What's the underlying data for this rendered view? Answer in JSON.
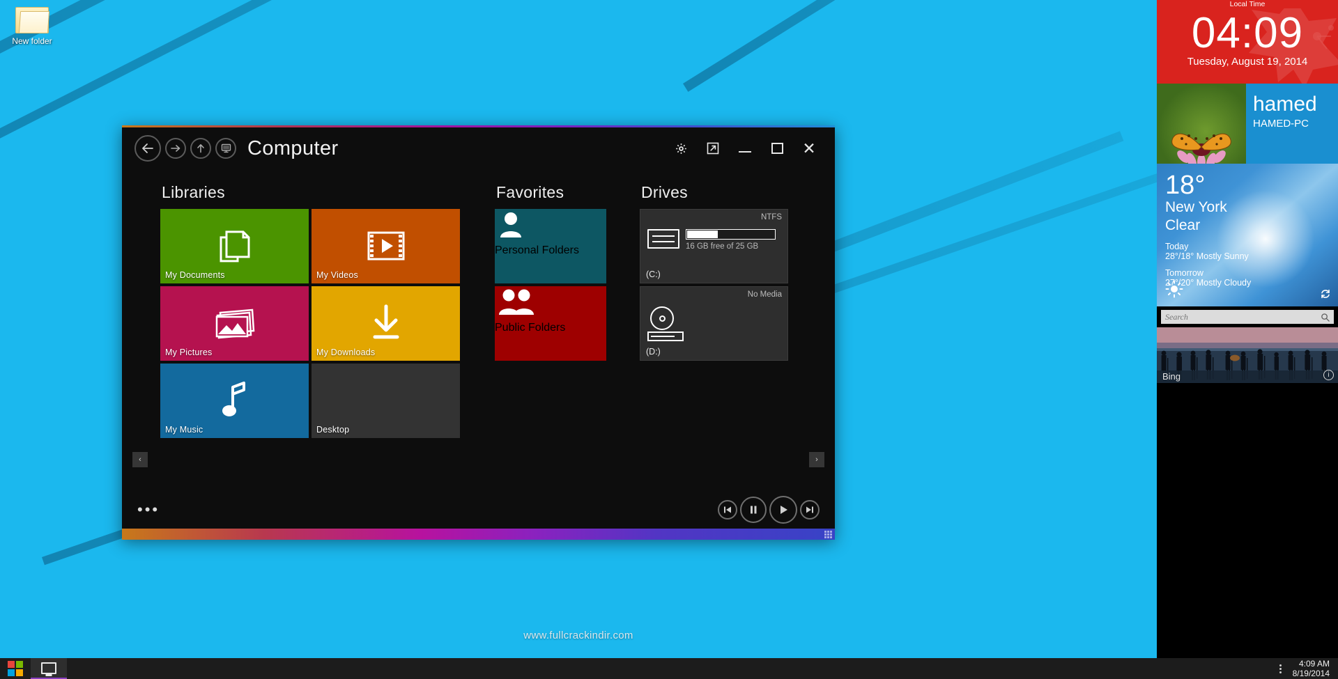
{
  "desktop": {
    "icon_label": "New folder",
    "watermark": "www.fullcrackindir.com",
    "wallpaper_color": "#1bb8ee"
  },
  "window": {
    "title": "Computer",
    "nav": {
      "back": "back-arrow",
      "forward": "forward-arrow",
      "up": "up-arrow",
      "computer": "computer-monitor"
    },
    "titlebar_buttons": {
      "settings": "gear-icon",
      "popout": "popout-icon",
      "minimize": "minimize-icon",
      "maximize": "maximize-icon",
      "close": "close-icon"
    },
    "sections": {
      "libraries": {
        "heading": "Libraries",
        "tiles": [
          {
            "label": "My Documents",
            "color": "#4b9400",
            "icon": "documents-icon"
          },
          {
            "label": "My Videos",
            "color": "#c14f00",
            "icon": "video-film-icon"
          },
          {
            "label": "My Pictures",
            "color": "#b5124f",
            "icon": "pictures-icon"
          },
          {
            "label": "My Downloads",
            "color": "#e2a600",
            "icon": "download-arrow-icon"
          },
          {
            "label": "My Music",
            "color": "#136a9e",
            "icon": "music-note-icon"
          },
          {
            "label": "Desktop",
            "color": "#333333",
            "icon": "desktop-icon"
          }
        ]
      },
      "favorites": {
        "heading": "Favorites",
        "tiles": [
          {
            "label": "Personal Folders",
            "color": "#0d5763",
            "icon": "single-person-icon"
          },
          {
            "label": "Public Folders",
            "color": "#9e0000",
            "icon": "two-people-icon"
          }
        ]
      },
      "drives": {
        "heading": "Drives",
        "items": [
          {
            "letter": "(C:)",
            "filesystem": "NTFS",
            "capacity_text": "16 GB free of 25 GB",
            "used_percent": 36,
            "icon": "hard-drive-icon"
          },
          {
            "letter": "(D:)",
            "filesystem": "No Media",
            "capacity_text": "",
            "used_percent": 0,
            "icon": "optical-drive-icon"
          }
        ]
      }
    },
    "scroll_left": "‹",
    "scroll_right": "›",
    "more_menu": "•••",
    "media_controls": {
      "previous": "previous-track-icon",
      "pause": "pause-icon",
      "play": "play-icon",
      "next": "next-track-icon"
    }
  },
  "sidepanel": {
    "local_time_label": "Local Time",
    "clock": {
      "time": "04:09",
      "date": "Tuesday, August 19, 2014",
      "color": "#d9231e"
    },
    "user": {
      "name": "hamed",
      "pc": "HAMED-PC",
      "tile_color": "#1a8fd0"
    },
    "weather": {
      "temperature": "18°",
      "city": "New York",
      "condition": "Clear",
      "today_label": "Today",
      "today_value": "28°/18° Mostly Sunny",
      "tomorrow_label": "Tomorrow",
      "tomorrow_value": "27°/20° Mostly Cloudy",
      "sun_icon": "sun-icon",
      "refresh_icon": "refresh-icon"
    },
    "search": {
      "placeholder": "Search",
      "value": "",
      "icon": "search-icon"
    },
    "bing": {
      "label": "Bing",
      "info_icon": "info-icon"
    }
  },
  "taskbar": {
    "start": "windows-logo",
    "explorer": "file-explorer-icon",
    "tray_expand": "tray-expand-icon",
    "time": "4:09 AM",
    "date": "8/19/2014"
  }
}
